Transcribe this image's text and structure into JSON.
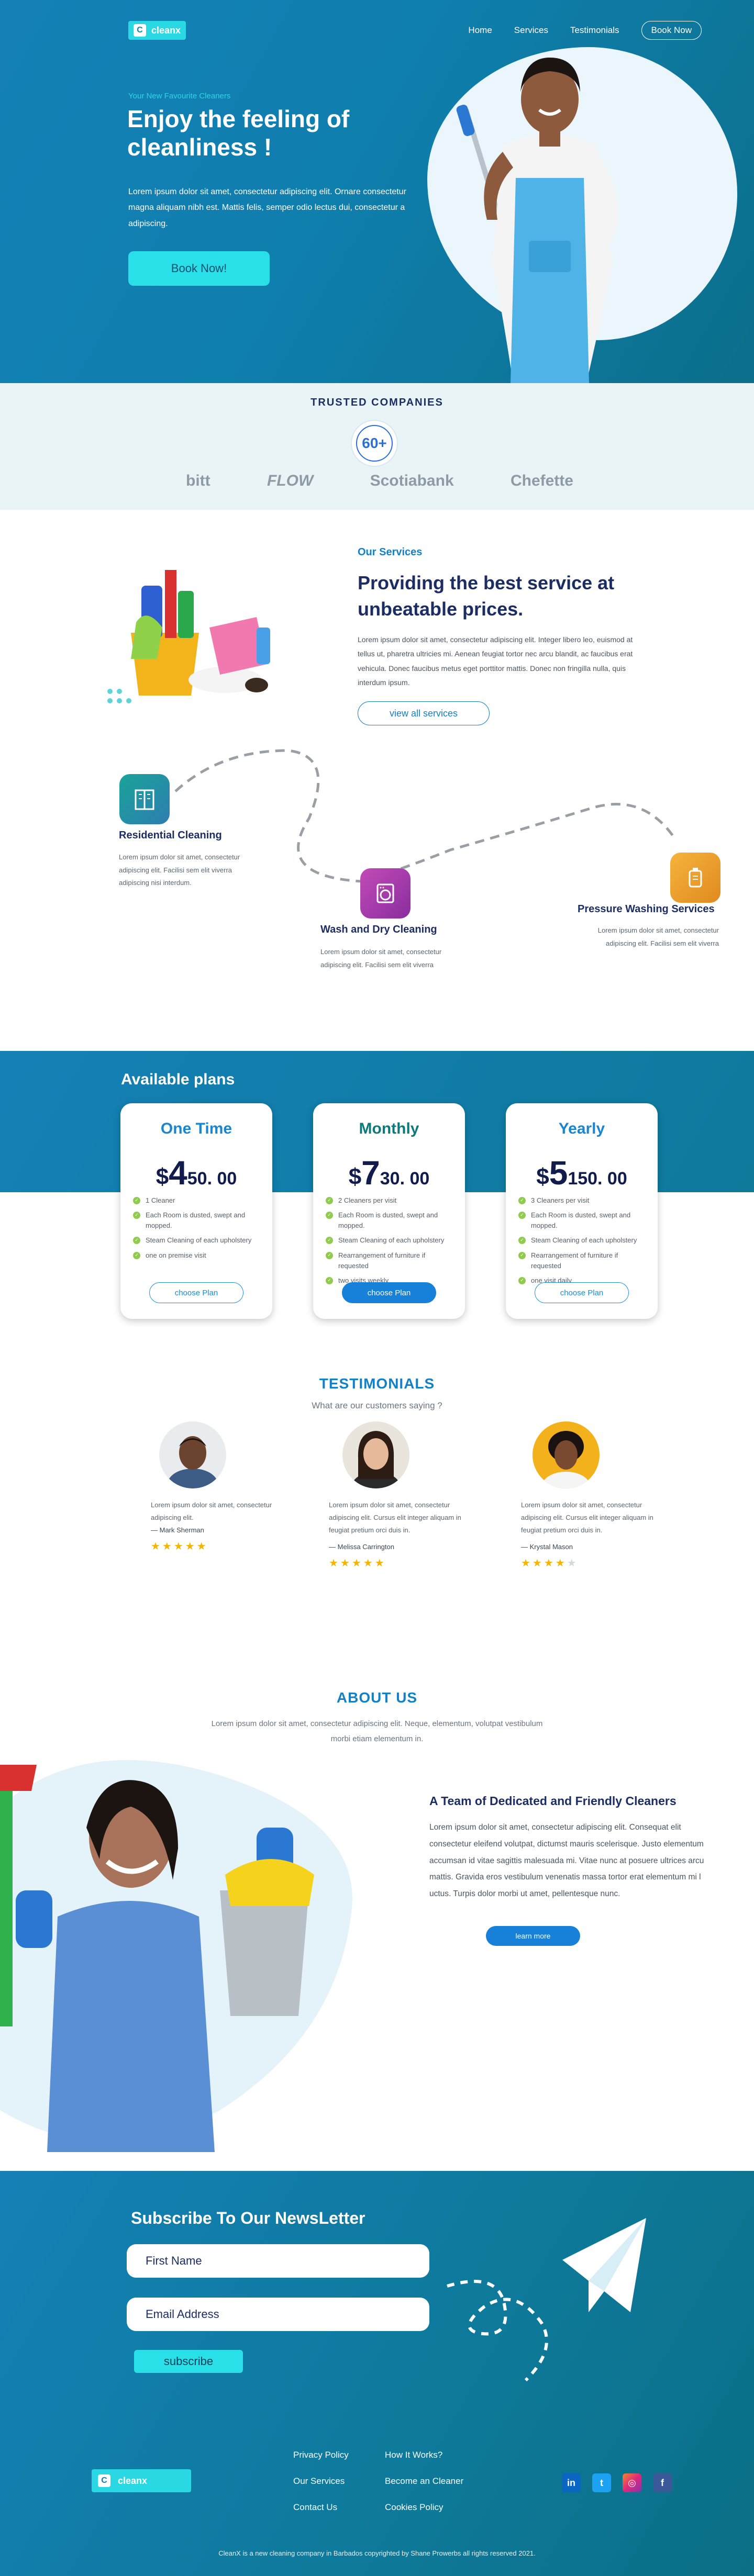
{
  "brand": {
    "logo_text": "cleanx"
  },
  "nav": {
    "links": [
      "Home",
      "Services",
      "Testimonials"
    ],
    "book": "Book Now"
  },
  "hero": {
    "eyebrow": "Your New Favourite Cleaners",
    "title": "Enjoy the feeling of cleanliness !",
    "description": "Lorem ipsum dolor sit amet, consectetur adipiscing elit. Ornare consectetur magna aliquam nibh est. Mattis felis, semper odio lectus dui, consectetur a adipiscing.",
    "button": "Book Now!"
  },
  "trusted": {
    "title": "TRUSTED COMPANIES",
    "count": "60+",
    "brands": [
      "bitt",
      "FLOW",
      "Scotiabank",
      "Chefette"
    ]
  },
  "services": {
    "eyebrow": "Our Services",
    "title": "Providing the best service at unbeatable prices.",
    "description": "Lorem ipsum dolor sit amet, consectetur adipiscing elit. Integer libero leo, euismod at tellus ut, pharetra ultricies mi. Aenean feugiat tortor nec arcu blandit, ac faucibus erat vehicula. Donec faucibus metus eget porttitor mattis. Donec non fringilla nulla, quis interdum ipsum.",
    "button": "view all services",
    "items": [
      {
        "name": "Residential Cleaning",
        "text": "Lorem ipsum dolor sit amet, consectetur adipiscing elit. Facilisi sem elit viverra adipiscing nisi interdum."
      },
      {
        "name": "Wash and Dry Cleaning",
        "text": "Lorem ipsum dolor sit amet, consectetur adipiscing elit. Facilisi sem elit viverra"
      },
      {
        "name": "Pressure Washing Services",
        "text": "Lorem ipsum dolor sit amet, consectetur adipiscing elit. Facilisi sem elit viverra"
      }
    ]
  },
  "plans": {
    "title": "Available plans",
    "items": [
      {
        "name": "One Time",
        "currency": "$",
        "whole": "4",
        "cents": "50. 00",
        "features": [
          "1 Cleaner",
          "Each Room is dusted, swept and mopped.",
          "Steam Cleaning of each upholstery",
          "one on premise visit"
        ],
        "button": "choose Plan",
        "style": "outline"
      },
      {
        "name": "Monthly",
        "currency": "$",
        "whole": "7",
        "cents": "30. 00",
        "features": [
          "2 Cleaners per visit",
          "Each Room is dusted, swept and mopped.",
          "Steam Cleaning of each upholstery",
          "Rearrangement of furniture if requested",
          "two visits weekly"
        ],
        "button": "choose Plan",
        "style": "solid"
      },
      {
        "name": "Yearly",
        "currency": "$",
        "whole": "5",
        "cents": "150. 00",
        "features": [
          "3 Cleaners per visit",
          "Each Room is dusted, swept and mopped.",
          "Steam Cleaning of each upholstery",
          "Rearrangement of furniture if requested",
          "one visit daily"
        ],
        "button": "choose Plan",
        "style": "outline"
      }
    ]
  },
  "testimonials": {
    "title": "TESTIMONIALS",
    "subtitle": "What are our customers saying ?",
    "items": [
      {
        "text": "Lorem ipsum dolor sit amet, consectetur adipiscing elit.",
        "author": "— Mark Sherman",
        "rating": 5
      },
      {
        "text": "Lorem ipsum dolor sit amet, consectetur adipiscing elit. Cursus elit integer aliquam in feugiat pretium orci duis in.",
        "author": "— Melissa Carrington",
        "rating": 5
      },
      {
        "text": "Lorem ipsum dolor sit amet, consectetur adipiscing elit. Cursus elit integer aliquam in feugiat pretium orci duis in.",
        "author": "— Krystal Mason",
        "rating": 4
      }
    ]
  },
  "about": {
    "title": "ABOUT US",
    "intro": "Lorem ipsum dolor sit amet, consectetur adipiscing elit. Neque, elementum, volutpat vestibulum morbi etiam elementum in.",
    "subtitle": "A Team of Dedicated and Friendly Cleaners",
    "text": "Lorem ipsum dolor sit amet, consectetur adipiscing elit. Consequat elit consectetur eleifend volutpat, dictumst mauris scelerisque. Justo elementum accumsan id vitae sagittis malesuada mi. Vitae nunc at posuere ultrices arcu mattis. Gravida eros vestibulum venenatis massa tortor erat elementum mi l uctus. Turpis dolor morbi ut amet, pellentesque nunc.",
    "button": "learn more"
  },
  "newsletter": {
    "title": "Subscribe To Our NewsLetter",
    "first_name_placeholder": "First Name",
    "email_placeholder": "Email Address",
    "button": "subscribe"
  },
  "footer": {
    "col1": [
      "Privacy Policy",
      "Our Services",
      "Contact Us"
    ],
    "col2": [
      "How It Works?",
      "Become an Cleaner",
      "Cookies Policy"
    ],
    "socials": [
      {
        "icon": "linkedin-icon",
        "glyph": "in",
        "color": "#0a66c2"
      },
      {
        "icon": "twitter-icon",
        "glyph": "t",
        "color": "#1da1f2"
      },
      {
        "icon": "instagram-icon",
        "glyph": "◎",
        "color": "#d6249f"
      },
      {
        "icon": "facebook-icon",
        "glyph": "f",
        "color": "#3b5998"
      }
    ],
    "copyright": "CleanX is a new cleaning company in Barbados copyrighted by Shane Prowerbs all rights reserved 2021."
  },
  "colors": {
    "primary": "#1480b6",
    "accent": "#2ae0e8",
    "navy": "#1c2d63",
    "button_blue": "#1780d8"
  }
}
